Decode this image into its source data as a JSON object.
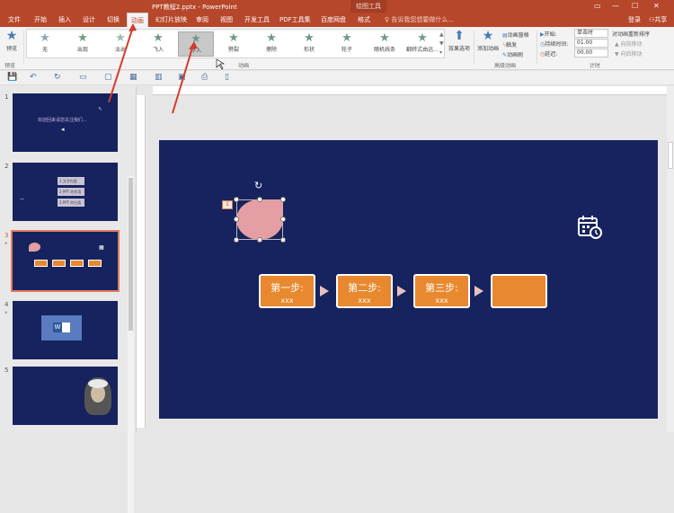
{
  "titlebar": {
    "doc_title": "PPT教程2.pptx - PowerPoint",
    "context_header": "绘图工具"
  },
  "tabs": [
    {
      "label": "文件"
    },
    {
      "label": "开始"
    },
    {
      "label": "插入"
    },
    {
      "label": "设计"
    },
    {
      "label": "切换"
    },
    {
      "label": "动画"
    },
    {
      "label": "幻灯片放映"
    },
    {
      "label": "审阅"
    },
    {
      "label": "视图"
    },
    {
      "label": "开发工具"
    },
    {
      "label": "PDF工具集"
    },
    {
      "label": "百度网盘"
    },
    {
      "label": "格式"
    }
  ],
  "search_placeholder": "告诉我您想要做什么...",
  "login": "登录",
  "share": "共享",
  "ribbon": {
    "preview_label": "预览",
    "preview_group": "预览",
    "animations_group": "动画",
    "gallery": [
      {
        "label": "无"
      },
      {
        "label": "出现"
      },
      {
        "label": "淡出"
      },
      {
        "label": "飞入"
      },
      {
        "label": "浮入"
      },
      {
        "label": "劈裂"
      },
      {
        "label": "擦除"
      },
      {
        "label": "形状"
      },
      {
        "label": "轮子"
      },
      {
        "label": "随机线条"
      },
      {
        "label": "翻转式由远..."
      }
    ],
    "effect_options": "效果选项",
    "add_animation": "添加动画",
    "animation_pane": "动画窗格",
    "trigger": "触发",
    "animation_painter": "动画刷",
    "advanced_group": "高级动画",
    "start_label": "开始:",
    "start_value": "单击时",
    "duration_label": "持续时间:",
    "duration_value": "01.00",
    "delay_label": "延迟:",
    "delay_value": "00.00",
    "timing_group": "计时",
    "reorder_title": "对动画重新排序",
    "move_earlier": "▲ 向前移动",
    "move_later": "▼ 向后移动"
  },
  "slides": [
    {
      "number": "1",
      "text": "欢迎回来请您关注我们..."
    },
    {
      "number": "2",
      "items": [
        "1 文字内容",
        "2 PPT 的作用",
        "3 PPT 的分类"
      ]
    },
    {
      "number": "3"
    },
    {
      "number": "4",
      "word_letter": "W"
    },
    {
      "number": "5"
    }
  ],
  "slide_main": {
    "anim_tag": "1",
    "steps": [
      {
        "title": "第一步:",
        "sub": "xxx"
      },
      {
        "title": "第二步:",
        "sub": "xxx"
      },
      {
        "title": "第三步:",
        "sub": "xxx"
      },
      {
        "title": "",
        "sub": ""
      }
    ]
  },
  "colors": {
    "accent": "#b7472a",
    "slide_bg": "#16235e",
    "step": "#e8892f",
    "shape": "#e49ea4"
  }
}
